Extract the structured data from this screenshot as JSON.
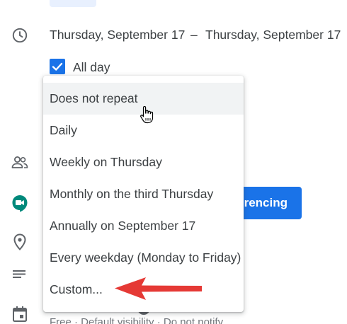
{
  "event": {
    "start_date": "Thursday, September 17",
    "date_separator": "–",
    "end_date": "Thursday, September 17",
    "all_day_label": "All day",
    "all_day_checked": true
  },
  "conferencing": {
    "button_label": "rencing"
  },
  "repeat_menu": {
    "selected_index": 0,
    "items": [
      {
        "label": "Does not repeat"
      },
      {
        "label": "Daily"
      },
      {
        "label": "Weekly on Thursday"
      },
      {
        "label": "Monthly on the third Thursday"
      },
      {
        "label": "Annually on September 17"
      },
      {
        "label": "Every weekday (Monday to Friday)"
      },
      {
        "label": "Custom..."
      }
    ]
  },
  "footer": {
    "status_text": "Free · Default visibility · Do not notify"
  },
  "colors": {
    "accent": "#1a73e8",
    "meet_green": "#00897b",
    "arrow_red": "#e53935",
    "menu_hover": "#f1f3f4"
  },
  "icons": {
    "clock": "clock-icon",
    "people": "people-icon",
    "meet": "google-meet-icon",
    "location": "location-pin-icon",
    "description": "description-lines-icon",
    "calendar": "calendar-icon",
    "checkbox": "checkmark-icon",
    "cursor": "hand-pointer-icon",
    "annotation": "red-arrow-icon"
  }
}
